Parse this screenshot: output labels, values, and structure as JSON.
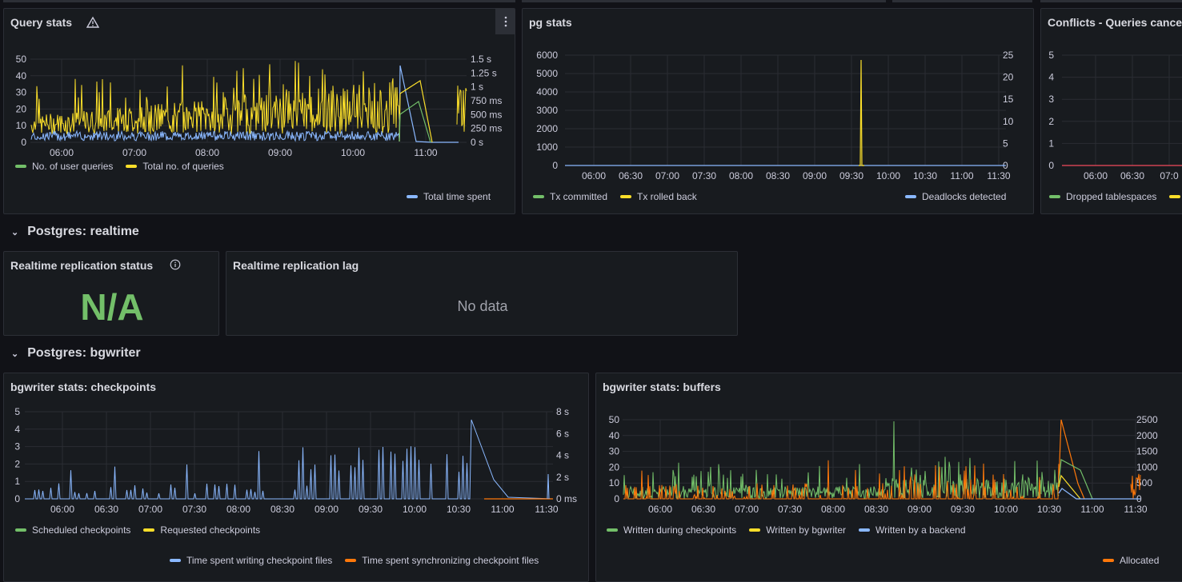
{
  "top_panels": {
    "query_stats": {
      "title": "Query stats",
      "legend": [
        "No. of user queries",
        "Total no. of queries",
        "Total time spent"
      ],
      "y_left_ticks": [
        "50",
        "40",
        "30",
        "20",
        "10",
        "0"
      ],
      "y_right_ticks": [
        "1.5 s",
        "1.25 s",
        "1 s",
        "750 ms",
        "500 ms",
        "250 ms",
        "0 s"
      ],
      "x_ticks": [
        "06:00",
        "07:00",
        "08:00",
        "09:00",
        "10:00",
        "11:00"
      ]
    },
    "pg_stats": {
      "title": "pg stats",
      "legend": [
        "Tx committed",
        "Tx rolled back",
        "Deadlocks detected"
      ],
      "y_left_ticks": [
        "6000",
        "5000",
        "4000",
        "3000",
        "2000",
        "1000",
        "0"
      ],
      "y_right_ticks": [
        "25",
        "20",
        "15",
        "10",
        "5",
        "0"
      ],
      "x_ticks": [
        "06:00",
        "06:30",
        "07:00",
        "07:30",
        "08:00",
        "08:30",
        "09:00",
        "09:30",
        "10:00",
        "10:30",
        "11:00",
        "11:30"
      ]
    },
    "conflicts": {
      "title": "Conflicts - Queries canceled due to",
      "legend": [
        "Dropped tablespaces",
        ""
      ],
      "y_left_ticks": [
        "5",
        "4",
        "3",
        "2",
        "1",
        "0"
      ],
      "x_ticks": [
        "06:00",
        "06:30",
        "07:0"
      ]
    }
  },
  "rows": {
    "realtime": "Postgres: realtime",
    "bgwriter": "Postgres: bgwriter"
  },
  "realtime": {
    "status_title": "Realtime replication status",
    "status_value": "N/A",
    "lag_title": "Realtime replication lag",
    "lag_value": "No data"
  },
  "bgwriter_panels": {
    "checkpoints": {
      "title": "bgwriter stats: checkpoints",
      "legend": [
        "Scheduled checkpoints",
        "Requested checkpoints",
        "Time spent writing checkpoint files",
        "Time spent synchronizing checkpoint files"
      ],
      "y_left_ticks": [
        "5",
        "4",
        "3",
        "2",
        "1",
        "0"
      ],
      "y_right_ticks": [
        "8 s",
        "6 s",
        "4 s",
        "2 s",
        "0 ms"
      ],
      "x_ticks": [
        "06:00",
        "06:30",
        "07:00",
        "07:30",
        "08:00",
        "08:30",
        "09:00",
        "09:30",
        "10:00",
        "10:30",
        "11:00",
        "11:30"
      ]
    },
    "buffers": {
      "title": "bgwriter stats: buffers",
      "legend": [
        "Written during checkpoints",
        "Written by bgwriter",
        "Written by a backend",
        "Allocated"
      ],
      "y_left_ticks": [
        "50",
        "40",
        "30",
        "20",
        "10",
        "0"
      ],
      "y_right_ticks": [
        "2500",
        "2000",
        "1500",
        "1000",
        "500",
        "0"
      ],
      "x_ticks": [
        "06:00",
        "06:30",
        "07:00",
        "07:30",
        "08:00",
        "08:30",
        "09:00",
        "09:30",
        "10:00",
        "10:30",
        "11:00",
        "11:30"
      ]
    }
  },
  "colors": {
    "green": "#73bf69",
    "yellow": "#fade2a",
    "blue": "#8ab8ff",
    "orange": "#ff780a",
    "red": "#f2495c"
  },
  "icons": [
    "warning-icon",
    "info-icon",
    "menu-icon",
    "chevron-down-icon"
  ]
}
